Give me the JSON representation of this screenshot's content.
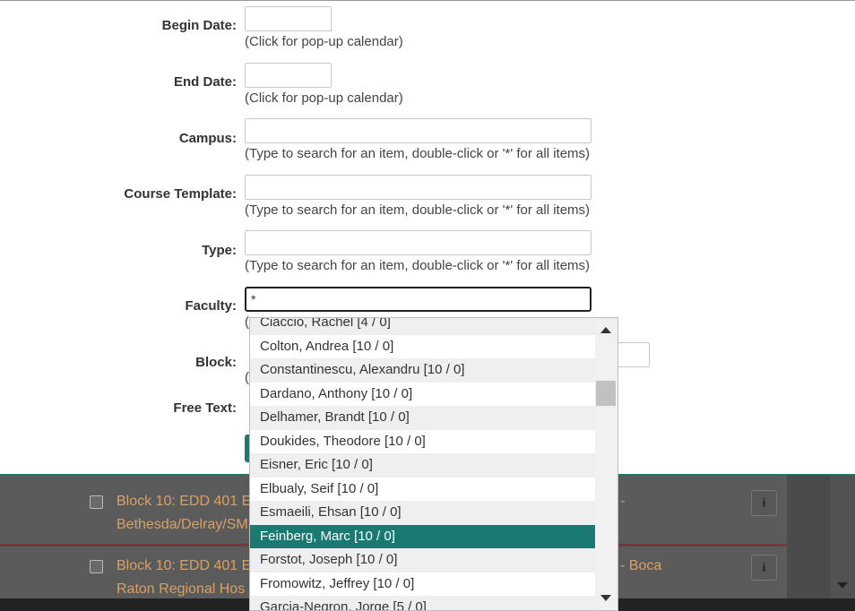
{
  "form": {
    "begin_date": {
      "label": "Begin Date:",
      "value": "",
      "hint": "(Click for pop-up calendar)"
    },
    "end_date": {
      "label": "End Date:",
      "value": "",
      "hint": "(Click for pop-up calendar)"
    },
    "campus": {
      "label": "Campus:",
      "value": "",
      "hint": "(Type to search for an item, double-click or '*' for all items)"
    },
    "course_template": {
      "label": "Course Template:",
      "value": "",
      "hint": "(Type to search for an item, double-click or '*' for all items)"
    },
    "type": {
      "label": "Type:",
      "value": "",
      "hint": "(Type to search for an item, double-click or '*' for all items)"
    },
    "faculty": {
      "label": "Faculty:",
      "value": "*",
      "hint_fragment": "("
    },
    "block": {
      "label": "Block:",
      "hint_fragment": "("
    },
    "free_text": {
      "label": "Free Text:"
    }
  },
  "faculty_dropdown": {
    "items": [
      "Ciaccio, Rachel [4 / 0]",
      "Colton, Andrea [10 / 0]",
      "Constantinescu, Alexandru [10 / 0]",
      "Dardano, Anthony [10 / 0]",
      "Delhamer, Brandt [10 / 0]",
      "Doukides, Theodore [10 / 0]",
      "Eisner, Eric [10 / 0]",
      "Elbualy, Seif [10 / 0]",
      "Esmaeili, Ehsan [10 / 0]",
      "Feinberg, Marc [10 / 0]",
      "Forstot, Joseph [10 / 0]",
      "Fromowitz, Jeffrey [10 / 0]",
      "Garcia-Negron, Jorge [5 / 0]"
    ],
    "selected_index": 9
  },
  "results": {
    "row1": {
      "line1": "Block 10: EDD 401 E",
      "line1_tail": "-",
      "line2": "Bethesda/Delray/SM"
    },
    "row2": {
      "line1": "Block 10: EDD 401 E",
      "line1_tail": "- Boca",
      "line2": "Raton Regional Hos"
    }
  },
  "icons": {
    "info": "i"
  },
  "colors": {
    "accent": "#1a7a72",
    "link": "#d8a066"
  }
}
